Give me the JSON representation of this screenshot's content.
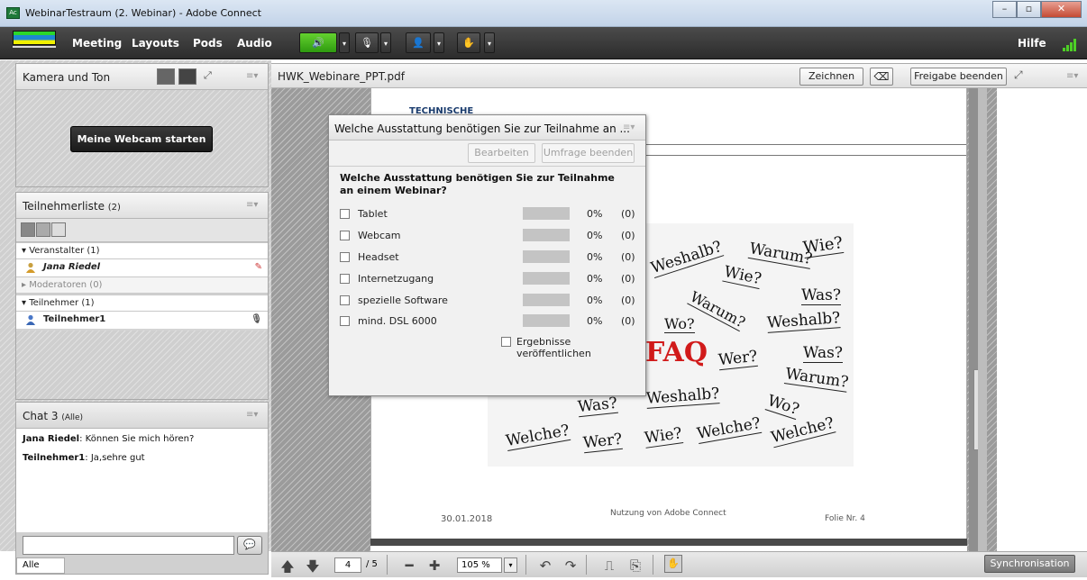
{
  "window": {
    "title": "WebinarTestraum (2. Webinar) - Adobe Connect",
    "app_icon": "Ac"
  },
  "menubar": {
    "items": [
      "Meeting",
      "Layouts",
      "Pods",
      "Audio"
    ],
    "help": "Hilfe"
  },
  "camera_pod": {
    "title": "Kamera und Ton",
    "start_button": "Meine Webcam starten"
  },
  "attendees": {
    "title": "Teilnehmerliste",
    "count": "(2)",
    "host_category": "Veranstalter (1)",
    "host_name": "Jana Riedel",
    "moderators_category": "Moderatoren (0)",
    "participants_category": "Teilnehmer (1)",
    "participant_name": "Teilnehmer1"
  },
  "chat": {
    "title": "Chat 3",
    "scope": "(Alle)",
    "messages": [
      {
        "sender": "Jana Riedel",
        "text": "Können Sie mich hören?"
      },
      {
        "sender": "Teilnehmer1",
        "text": "Ja,sehre gut"
      }
    ],
    "input_placeholder": "",
    "recipient": "Alle"
  },
  "share_pod": {
    "filename": "HWK_Webinare_PPT.pdf",
    "draw_button": "Zeichnen",
    "stop_share_button": "Freigabe beenden"
  },
  "slide": {
    "header_text": "TECHNISCHE",
    "words": [
      "Wie?",
      "Weshalb?",
      "Warum?",
      "Wie?",
      "Was?",
      "Warum?",
      "Wo?",
      "Weshalb?",
      "FAQ",
      "Wer?",
      "Was?",
      "Warum?",
      "Was?",
      "Weshalb?",
      "Wo?",
      "Welche?",
      "Wer?",
      "Wie?",
      "Welche?",
      "Welche?"
    ],
    "footer_date": "30.01.2018",
    "footer_center": "Nutzung von Adobe Connect",
    "footer_right": "Folie Nr. 4"
  },
  "poll": {
    "title": "Welche Ausstattung benötigen Sie zur Teilnahme an ...",
    "edit_button": "Bearbeiten",
    "end_button": "Umfrage beenden",
    "question": "Welche Ausstattung benötigen Sie zur Teilnahme an einem Webinar?",
    "options": [
      {
        "label": "Tablet",
        "percent": "0%",
        "count": "(0)"
      },
      {
        "label": "Webcam",
        "percent": "0%",
        "count": "(0)"
      },
      {
        "label": "Headset",
        "percent": "0%",
        "count": "(0)"
      },
      {
        "label": "Internetzugang",
        "percent": "0%",
        "count": "(0)"
      },
      {
        "label": "spezielle Software",
        "percent": "0%",
        "count": "(0)"
      },
      {
        "label": "mind. DSL 6000",
        "percent": "0%",
        "count": "(0)"
      }
    ],
    "publish_label": "Ergebnisse veröffentlichen"
  },
  "doc_toolbar": {
    "page": "4",
    "total": "/ 5",
    "zoom": "105 %",
    "sync": "Synchronisation"
  },
  "colors": {
    "menubar": "#333333",
    "audio_green": "#3fb01c",
    "faq_red": "#d11a1a"
  }
}
